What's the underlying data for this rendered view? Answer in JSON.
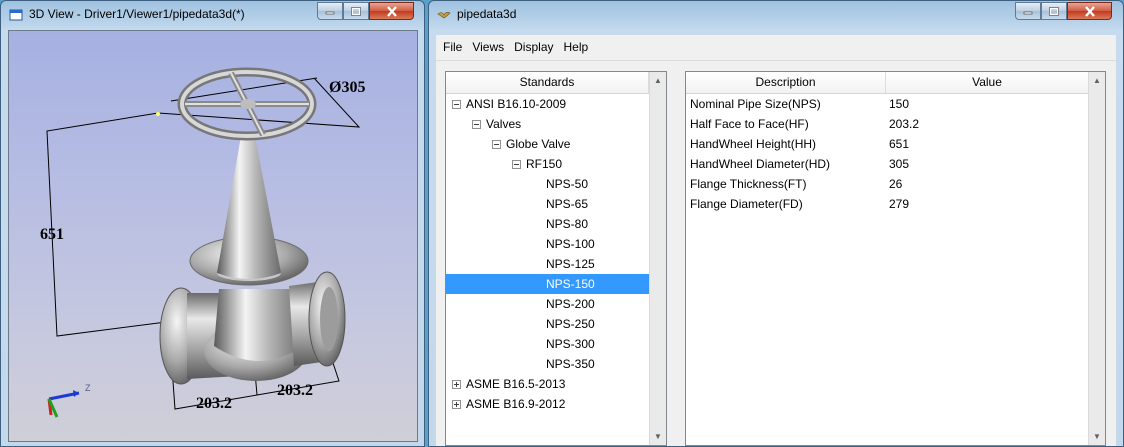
{
  "left_window": {
    "title": "3D View - Driver1/Viewer1/pipedata3d(*)",
    "dimensions": {
      "diameter": "Ø305",
      "height": "651",
      "half_left": "203.2",
      "half_right": "203.2"
    },
    "axis": {
      "z": "Z"
    }
  },
  "right_window": {
    "title": "pipedata3d",
    "menu": [
      "File",
      "Views",
      "Display",
      "Help"
    ],
    "tree": {
      "header": "Standards",
      "nodes": [
        {
          "label": "ANSI B16.10-2009",
          "level": 0,
          "expander": "minus"
        },
        {
          "label": "Valves",
          "level": 1,
          "expander": "minus"
        },
        {
          "label": "Globe Valve",
          "level": 2,
          "expander": "minus"
        },
        {
          "label": "RF150",
          "level": 3,
          "expander": "minus"
        },
        {
          "label": "NPS-50",
          "level": 4,
          "expander": "none"
        },
        {
          "label": "NPS-65",
          "level": 4,
          "expander": "none"
        },
        {
          "label": "NPS-80",
          "level": 4,
          "expander": "none"
        },
        {
          "label": "NPS-100",
          "level": 4,
          "expander": "none"
        },
        {
          "label": "NPS-125",
          "level": 4,
          "expander": "none"
        },
        {
          "label": "NPS-150",
          "level": 4,
          "expander": "none",
          "selected": true
        },
        {
          "label": "NPS-200",
          "level": 4,
          "expander": "none"
        },
        {
          "label": "NPS-250",
          "level": 4,
          "expander": "none"
        },
        {
          "label": "NPS-300",
          "level": 4,
          "expander": "none"
        },
        {
          "label": "NPS-350",
          "level": 4,
          "expander": "none"
        },
        {
          "label": "ASME B16.5-2013",
          "level": 0,
          "expander": "plus"
        },
        {
          "label": "ASME B16.9-2012",
          "level": 0,
          "expander": "plus"
        }
      ]
    },
    "table": {
      "columns": [
        "Description",
        "Value"
      ],
      "rows": [
        [
          "Nominal Pipe Size(NPS)",
          "150"
        ],
        [
          "Half Face to Face(HF)",
          "203.2"
        ],
        [
          "HandWheel Height(HH)",
          "651"
        ],
        [
          "HandWheel Diameter(HD)",
          "305"
        ],
        [
          "Flange Thickness(FT)",
          "26"
        ],
        [
          "Flange Diameter(FD)",
          "279"
        ]
      ]
    }
  },
  "colors": {
    "selection": "#3399ff",
    "close_button": "#c43a1f",
    "title_bar": "#b9d3ea"
  }
}
